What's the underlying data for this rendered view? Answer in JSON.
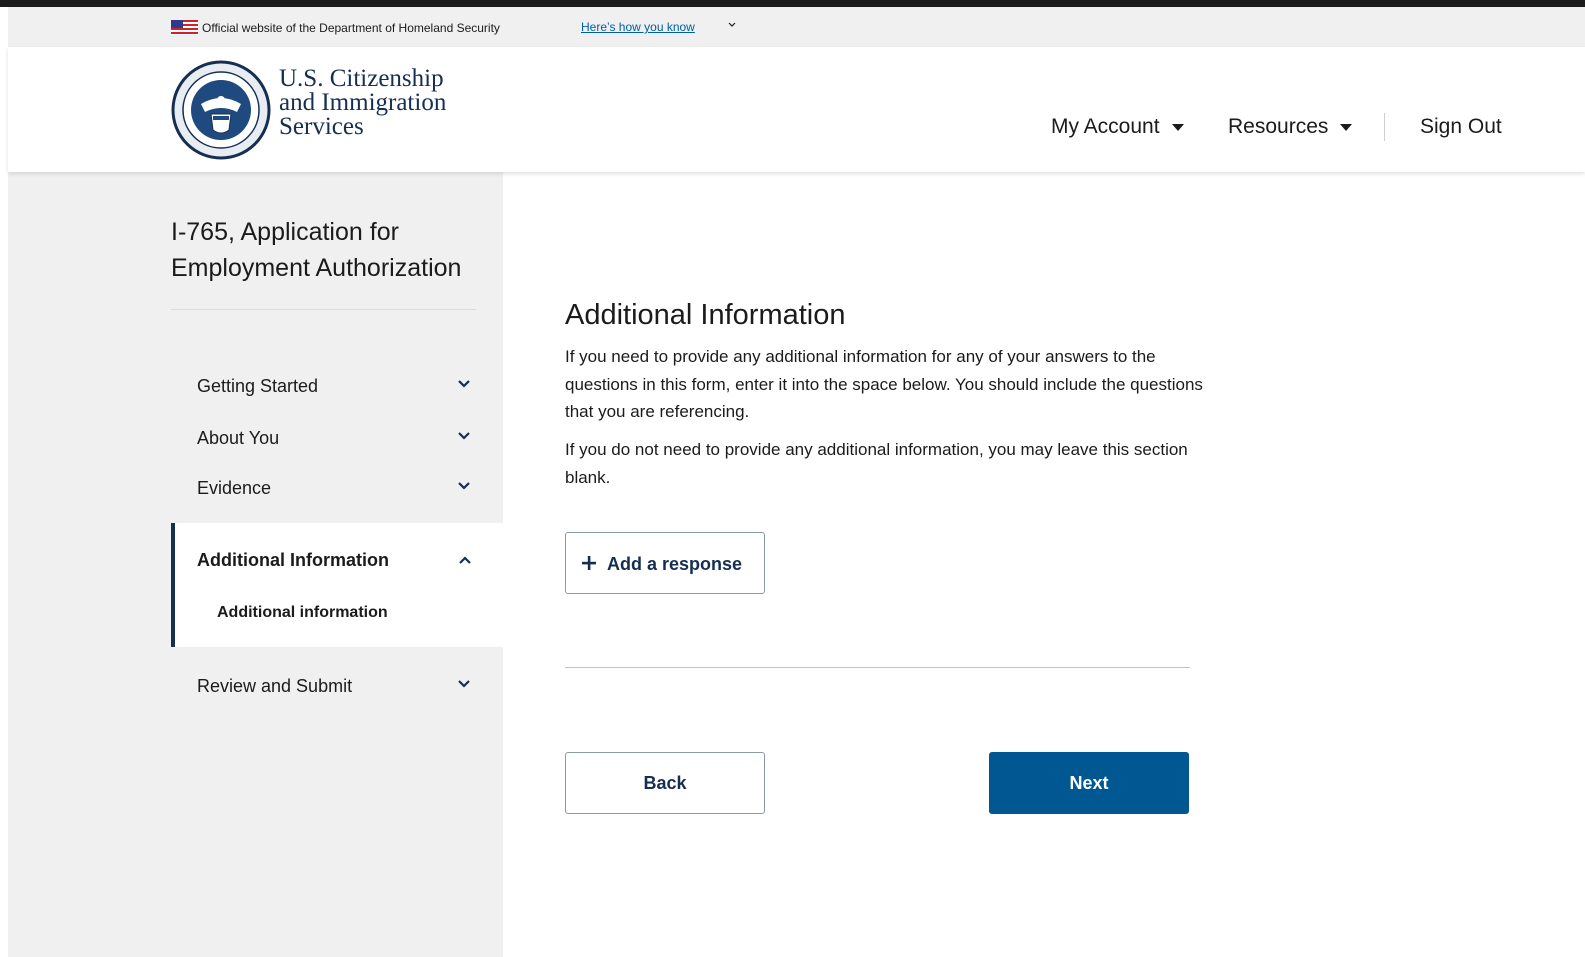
{
  "gov_banner": {
    "text": "Official website of the Department of Homeland Security",
    "link": "Here’s how you know"
  },
  "header": {
    "agency_line1": "U.S. Citizenship",
    "agency_line2": "and Immigration",
    "agency_line3": "Services",
    "nav": {
      "my_account": "My Account",
      "resources": "Resources",
      "sign_out": "Sign Out"
    }
  },
  "sidebar": {
    "form_title": "I-765, Application for Employment Authorization",
    "items": [
      {
        "label": "Getting Started"
      },
      {
        "label": "About You"
      },
      {
        "label": "Evidence"
      },
      {
        "label": "Additional Information",
        "sub": "Additional information"
      },
      {
        "label": "Review and Submit"
      }
    ]
  },
  "main": {
    "title": "Additional Information",
    "para1": "If you need to provide any additional information for any of your answers to the questions in this form, enter it into the space below. You should include the questions that you are referencing.",
    "para2": "If you do not need to provide any additional information, you may leave this section blank.",
    "add_response": "Add a response",
    "back": "Back",
    "next": "Next"
  },
  "colors": {
    "brand_navy": "#162e51",
    "primary_button": "#005791",
    "link_blue": "#005ea2",
    "sidebar_bg": "#f0f0f0"
  },
  "icons": [
    "us-flag-icon",
    "chevron-down-icon",
    "caret-down-icon",
    "chevron-up-icon",
    "plus-icon",
    "dhs-seal-icon"
  ]
}
